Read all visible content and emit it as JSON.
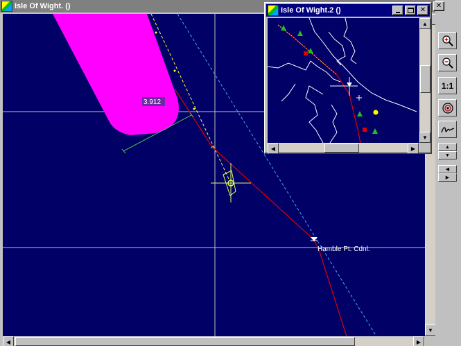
{
  "main_window": {
    "title": "Isle Of Wight. ()"
  },
  "inset_window": {
    "title": "Isle Of Wight.2 ()"
  },
  "chart": {
    "distance_label": "3.912",
    "waypoint_label": "Hamble Pt. Cdnl."
  },
  "toolbar": {
    "zoom_in_icon": "zoom-in-icon",
    "zoom_out_icon": "zoom-out-icon",
    "actual_size_label": "1:1",
    "target_icon": "target-icon",
    "signature_icon": "signature-icon"
  },
  "colors": {
    "sea": "#000066",
    "grid": "#c0c0c0",
    "route": "#e00000",
    "heading": "#ffff40",
    "channel": "#4aa6ff",
    "hazard_zone": "#ff00ff",
    "cross_track": "#40c040",
    "vessel": "#e0ff60",
    "coastline": "#ffffff",
    "inactive_title": "#808080",
    "active_title": "#000080"
  }
}
